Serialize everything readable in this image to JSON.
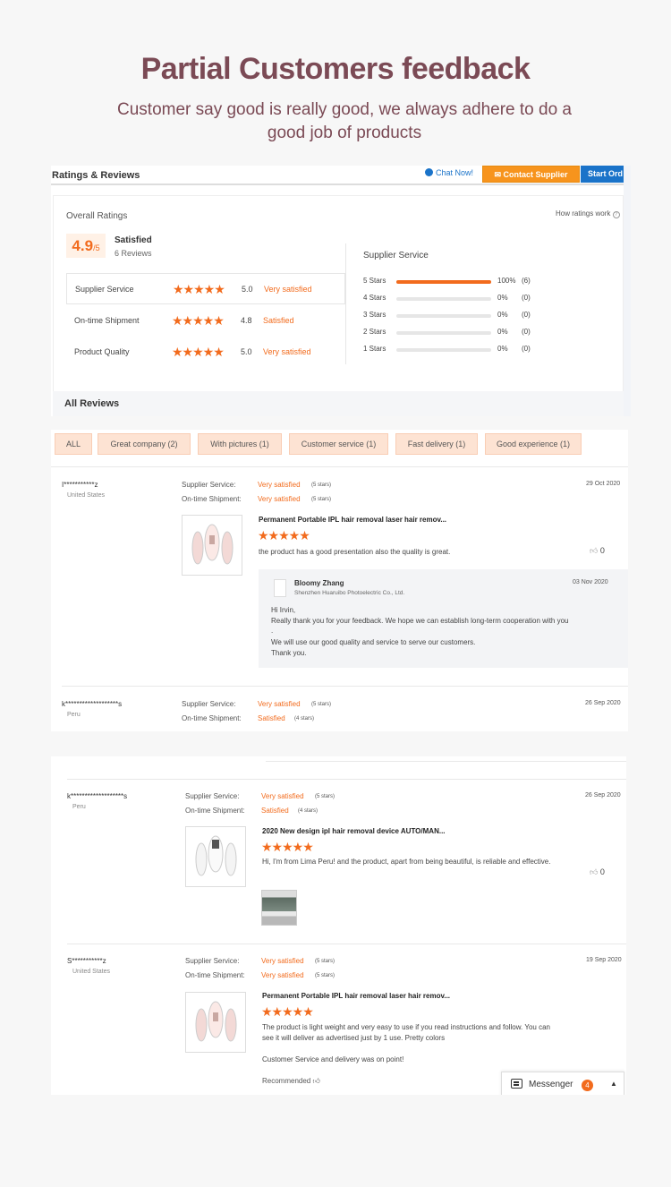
{
  "hero": {
    "title": "Partial Customers feedback",
    "subtitle": "Customer say good is really good, we always adhere to do a good job of products"
  },
  "ratings_panel": {
    "title": "Ratings & Reviews",
    "chat_now": "Chat Now!",
    "contact_supplier": "Contact Supplier",
    "start_order": "Start Ord",
    "overall_label": "Overall Ratings",
    "how_ratings_work": "How ratings work",
    "score": "4.9",
    "score_suffix": "/5",
    "satisfied": "Satisfied",
    "review_count": "6 Reviews",
    "rows": [
      {
        "name": "Supplier Service",
        "stars": "★★★★★",
        "value": "5.0",
        "text": "Very satisfied"
      },
      {
        "name": "On-time Shipment",
        "stars": "★★★★★",
        "value": "4.8",
        "text": "Satisfied"
      },
      {
        "name": "Product Quality",
        "stars": "★★★★★",
        "value": "5.0",
        "text": "Very satisfied"
      }
    ],
    "supplier_service_title": "Supplier Service",
    "distribution": [
      {
        "label": "5 Stars",
        "pct": "100%",
        "count": "(6)",
        "fill": 1.0
      },
      {
        "label": "4 Stars",
        "pct": "0%",
        "count": "(0)",
        "fill": 0
      },
      {
        "label": "3 Stars",
        "pct": "0%",
        "count": "(0)",
        "fill": 0
      },
      {
        "label": "2 Stars",
        "pct": "0%",
        "count": "(0)",
        "fill": 0
      },
      {
        "label": "1 Stars",
        "pct": "0%",
        "count": "(0)",
        "fill": 0
      }
    ],
    "all_reviews": "All Reviews"
  },
  "filters": [
    "ALL",
    "Great company (2)",
    "With pictures (1)",
    "Customer service (1)",
    "Fast delivery (1)",
    "Good experience (1)"
  ],
  "labels": {
    "supplier_service": "Supplier Service:",
    "ontime_shipment": "On-time Shipment:",
    "very_satisfied": "Very satisfied",
    "satisfied": "Satisfied",
    "five_stars": "(5 stars)",
    "four_stars": "(4 stars)",
    "stars": "★★★★★"
  },
  "review1": {
    "user": "I***********z",
    "country": "United States",
    "date": "29 Oct 2020",
    "product": "Permanent Portable IPL hair removal laser hair remov...",
    "text": "the product has a good presentation also the quality is great.",
    "likes": "0",
    "reply": {
      "name": "Bloomy Zhang",
      "company": "Shenzhen Huaruibo Photoelectric Co., Ltd.",
      "date": "03 Nov 2020",
      "line1": "Hi Irvin,",
      "line2": "Really thank you for your feedback. We hope we can establish long-term cooperation with you",
      "line3": ".",
      "line4": "We will use our good quality and service to serve our customers.",
      "line5": "Thank you."
    }
  },
  "review2": {
    "user": "k*******************s",
    "country": "Peru",
    "date": "26 Sep 2020"
  },
  "review3": {
    "user": "k*******************s",
    "country": "Peru",
    "date": "26 Sep 2020",
    "product": "2020 New design ipl hair removal device AUTO/MAN...",
    "text": "Hi, I'm from Lima Peru! and the product, apart from being beautiful, is reliable and effective.",
    "likes": "0"
  },
  "review4": {
    "user": "S***********z",
    "country": "United States",
    "date": "19 Sep 2020",
    "product": "Permanent Portable IPL hair removal laser hair remov...",
    "text": "The product is light weight and very easy to use if you read instructions and follow. You can see it will deliver as advertised just by 1 use. Pretty colors",
    "text2": "Customer Service and delivery was on point!",
    "recommended": "Recommended"
  },
  "messenger": {
    "label": "Messenger",
    "badge": "4"
  }
}
